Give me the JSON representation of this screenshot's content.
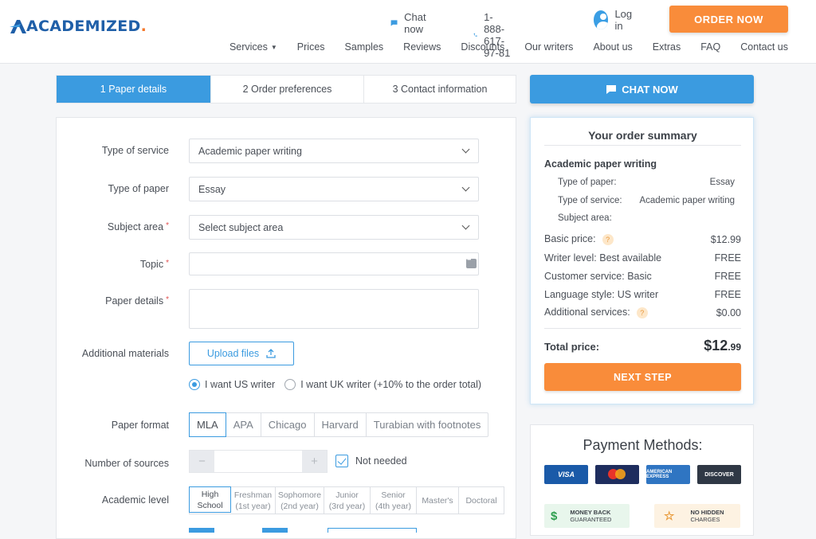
{
  "header": {
    "logo": "ACADEMIZED",
    "chat_label": "Chat now",
    "phone": "1-888-617-97-81",
    "login_label": "Log in",
    "order_now": "ORDER NOW",
    "nav": [
      "Services",
      "Prices",
      "Samples",
      "Reviews",
      "Discounts",
      "Our writers",
      "About us",
      "Extras",
      "FAQ",
      "Contact us"
    ]
  },
  "steps": [
    "1  Paper details",
    "2  Order preferences",
    "3  Contact information"
  ],
  "form": {
    "type_of_service": {
      "label": "Type of service",
      "value": "Academic paper writing"
    },
    "type_of_paper": {
      "label": "Type of paper",
      "value": "Essay"
    },
    "subject_area": {
      "label": "Subject area",
      "value": "Select subject area"
    },
    "topic": {
      "label": "Topic",
      "value": ""
    },
    "paper_details": {
      "label": "Paper details",
      "value": ""
    },
    "additional_materials": {
      "label": "Additional materials",
      "button": "Upload files"
    },
    "writer_us": "I want US writer",
    "writer_uk": "I want UK writer (+10% to the order total)",
    "paper_format": {
      "label": "Paper format",
      "options": [
        "MLA",
        "APA",
        "Chicago",
        "Harvard",
        "Turabian with footnotes"
      ],
      "selected": "MLA"
    },
    "number_of_sources": {
      "label": "Number of sources",
      "minus": "−",
      "plus": "+",
      "value": "",
      "not_needed": "Not needed"
    },
    "academic_level": {
      "label": "Academic level",
      "options": [
        {
          "l1": "High",
          "l2": "School"
        },
        {
          "l1": "Freshman",
          "l2": "(1st year)"
        },
        {
          "l1": "Sophomore",
          "l2": "(2nd year)"
        },
        {
          "l1": "Junior",
          "l2": "(3rd year)"
        },
        {
          "l1": "Senior",
          "l2": "(4th year)"
        },
        {
          "l1": "Master's",
          "l2": ""
        },
        {
          "l1": "Doctoral",
          "l2": ""
        }
      ],
      "selected": "High School"
    }
  },
  "sidebar": {
    "chat_now": "CHAT NOW",
    "summary": {
      "title": "Your order summary",
      "service_head": "Academic paper writing",
      "type_of_paper_label": "Type of paper:",
      "type_of_paper_value": "Essay",
      "type_of_service_label": "Type of service:",
      "type_of_service_value": "Academic paper writing",
      "subject_area_label": "Subject area:",
      "basic_price_label": "Basic price:",
      "basic_price_value": "$12.99",
      "writer_level_label": "Writer level: Best available",
      "writer_level_value": "FREE",
      "customer_service_label": "Customer service: Basic",
      "customer_service_value": "FREE",
      "language_style_label": "Language style: US writer",
      "language_style_value": "FREE",
      "additional_services_label": "Additional services:",
      "additional_services_value": "$0.00",
      "total_label": "Total price:",
      "total_main": "$12",
      "total_cents": ".99",
      "next_step": "NEXT STEP"
    },
    "payment": {
      "title": "Payment Methods:",
      "cards": [
        "VISA",
        "mastercard",
        "AMERICAN EXPRESS",
        "DISCOVER"
      ],
      "money_back_1": "MONEY BACK",
      "money_back_2": "GUARANTEED",
      "no_hidden_1": "NO HIDDEN",
      "no_hidden_2": "CHARGES"
    }
  },
  "colors": {
    "primary": "#3b9be0",
    "accent": "#f98c3a",
    "brand": "#1f5fa8"
  }
}
